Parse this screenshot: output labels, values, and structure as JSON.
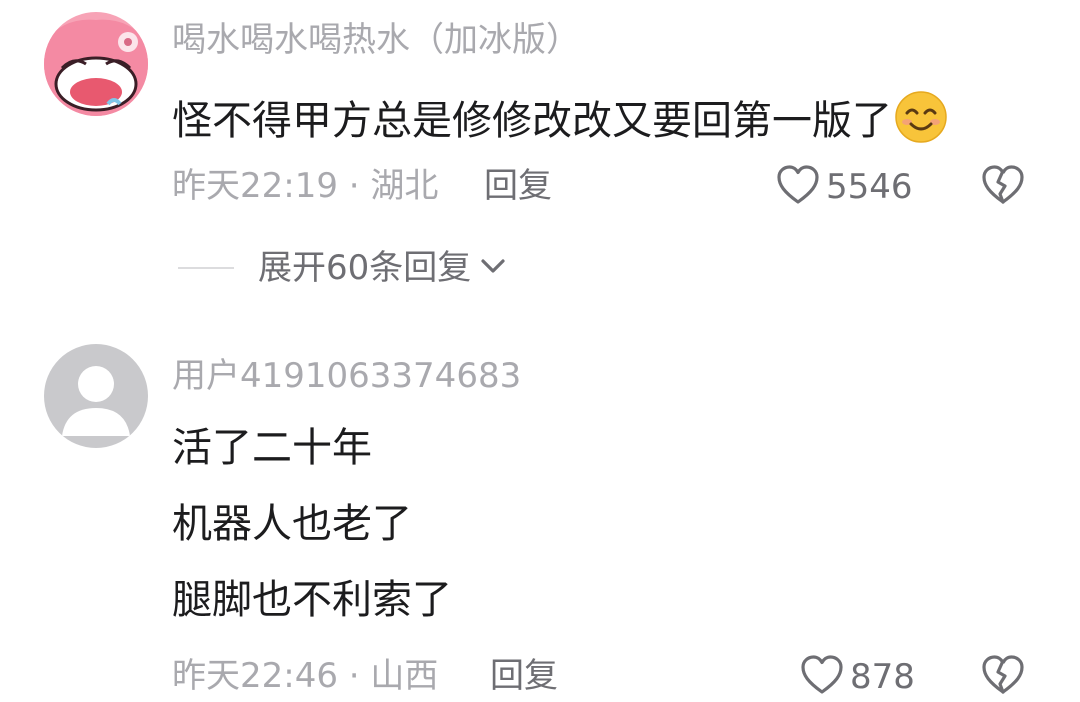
{
  "comments": [
    {
      "username": "喝水喝水喝热水（加冰版）",
      "lines": [
        "怪不得甲方总是修修改改又要回第一版了"
      ],
      "emoji": "smiling-face-emoji",
      "time_location": "昨天22:19 · 湖北",
      "reply_label": "回复",
      "likes": "5546",
      "expand_label": "展开60条回复"
    },
    {
      "username": "用户4191063374683",
      "lines": [
        "活了二十年",
        "机器人也老了",
        "腿脚也不利索了"
      ],
      "time_location": "昨天22:46 · 山西",
      "reply_label": "回复",
      "likes": "878"
    }
  ],
  "icons": {
    "like": "heart-outline-icon",
    "dislike": "broken-heart-icon",
    "expand": "chevron-down-icon"
  },
  "colors": {
    "username": "#a9a9ae",
    "body_text": "#1c1c1e",
    "secondary": "#6e6e73",
    "avatar1_bg": "#f7a3b6",
    "avatar2_bg": "#c9c9cc"
  }
}
